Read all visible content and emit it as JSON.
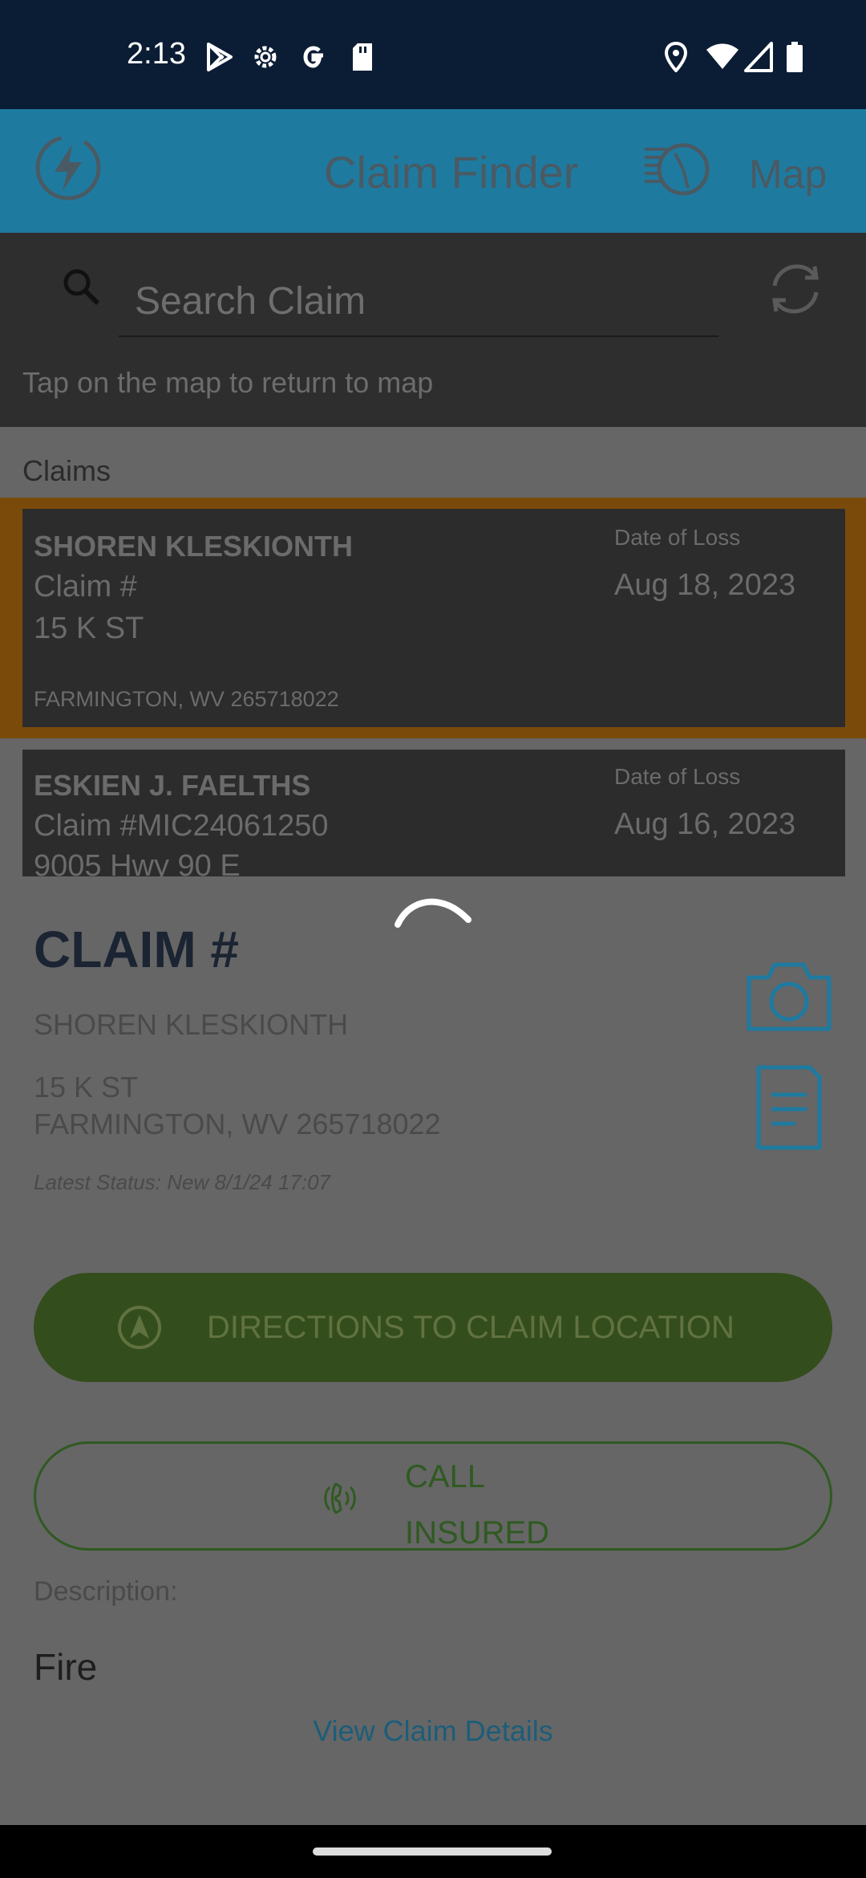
{
  "status_bar": {
    "time": "2:13",
    "icons": [
      "play-store-icon",
      "settings-icon",
      "google-icon",
      "sd-card-icon",
      "location-icon",
      "wifi-icon",
      "signal-icon",
      "battery-icon"
    ]
  },
  "app_bar": {
    "title": "Claim Finder",
    "map_label": "Map",
    "colors": {
      "background": "#1f7aa0"
    }
  },
  "search": {
    "placeholder": "Search Claim",
    "hint": "Tap on the map to return to map"
  },
  "claims_list": {
    "label": "Claims",
    "items": [
      {
        "name": "SHOREN KLESKIONTH",
        "claim_line": "Claim #",
        "address": "15 K ST",
        "city": "FARMINGTON, WV 265718022",
        "dol_label": "Date of Loss",
        "dol": "Aug 18, 2023",
        "selected": true
      },
      {
        "name": "ESKIEN J. FAELTHS",
        "claim_line": "Claim #MIC24061250",
        "address": "9005 Hwy 90 E",
        "city": "",
        "dol_label": "Date of Loss",
        "dol": "Aug 16, 2023",
        "selected": false
      }
    ]
  },
  "detail": {
    "title": "CLAIM #",
    "insured": "SHOREN KLESKIONTH",
    "address_line1": "15 K ST",
    "address_line2": "FARMINGTON, WV 265718022",
    "latest_status": "Latest Status: New 8/1/24 17:07",
    "directions_label": "DIRECTIONS TO CLAIM LOCATION",
    "call_label_1": "CALL",
    "call_label_2": "INSURED",
    "description_label": "Description:",
    "description_value": "Fire",
    "view_details": "View Claim Details",
    "colors": {
      "directions_button": "#344d1c",
      "call_outline": "#2f5a21",
      "link": "#1c5d79",
      "icon_accent": "#1f7aa0"
    }
  }
}
